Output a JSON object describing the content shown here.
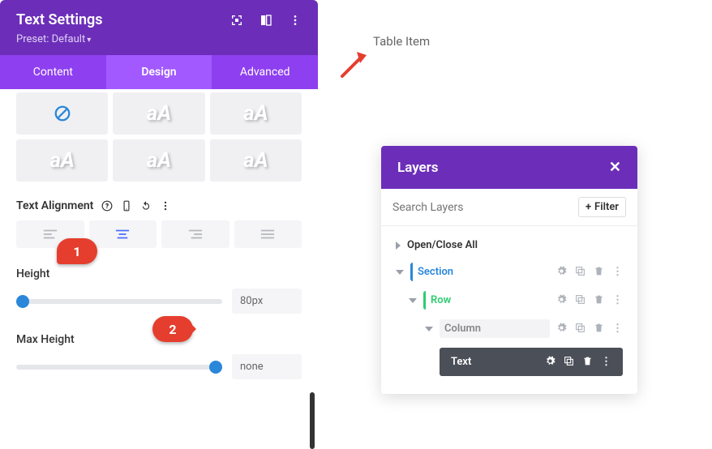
{
  "settings": {
    "title": "Text Settings",
    "preset_label": "Preset: Default",
    "tabs": {
      "content": "Content",
      "design": "Design",
      "advanced": "Advanced"
    },
    "text_alignment_label": "Text Alignment",
    "height_label": "Height",
    "height_value": "80px",
    "max_height_label": "Max Height",
    "max_height_value": "none"
  },
  "canvas": {
    "table_item": "Table Item"
  },
  "annotations": {
    "marker1": "1",
    "marker2": "2"
  },
  "layers": {
    "title": "Layers",
    "search_placeholder": "Search Layers",
    "filter_label": "Filter",
    "expand_all": "Open/Close All",
    "items": {
      "section": "Section",
      "row": "Row",
      "column": "Column",
      "text": "Text"
    }
  }
}
